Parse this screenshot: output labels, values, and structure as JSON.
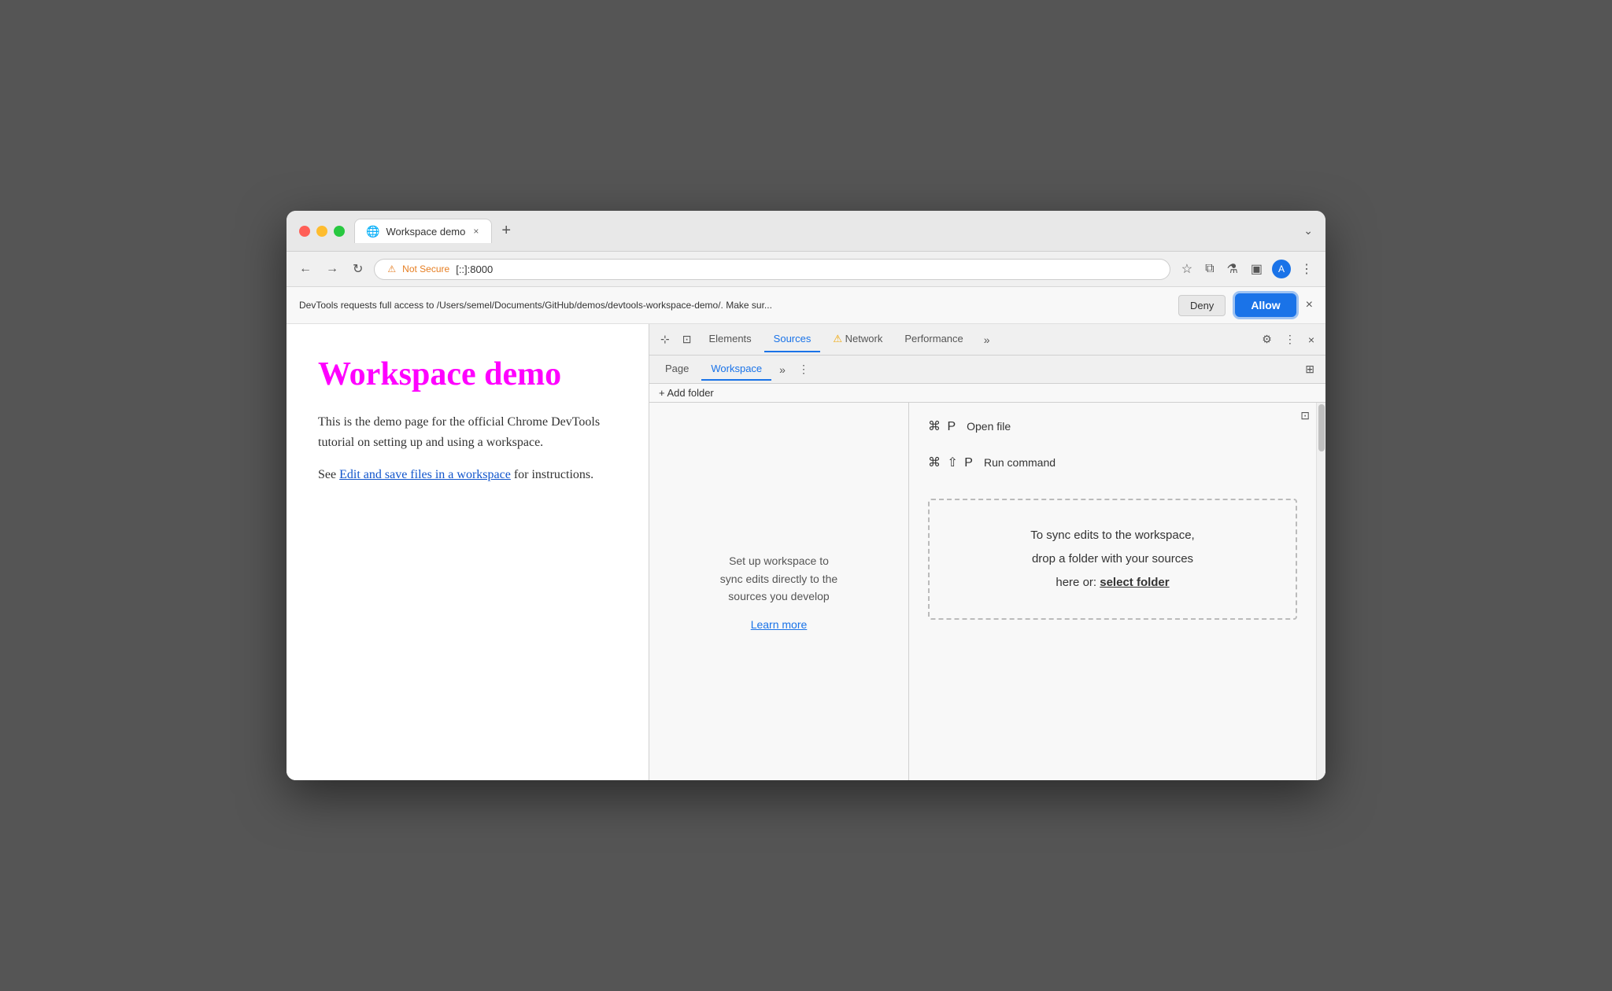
{
  "browser": {
    "tab": {
      "title": "Workspace demo",
      "icon": "🌐"
    },
    "new_tab_label": "+",
    "tab_more_label": "⌄"
  },
  "navbar": {
    "back_btn": "←",
    "forward_btn": "→",
    "reload_btn": "↻",
    "address": {
      "warning_icon": "⚠",
      "warning_text": "Not Secure",
      "url": "[::]:8000"
    },
    "bookmark_icon": "☆",
    "extension_icon": "⧉",
    "experiment_icon": "⚗",
    "sidebar_icon": "▣",
    "profile_initial": "A",
    "menu_icon": "⋮"
  },
  "notification": {
    "text": "DevTools requests full access to /Users/semel/Documents/GitHub/demos/devtools-workspace-demo/. Make sur...",
    "deny_label": "Deny",
    "allow_label": "Allow",
    "close_icon": "×"
  },
  "webpage": {
    "title": "Workspace demo",
    "paragraph1": "This is the demo page for the official Chrome DevTools tutorial on setting up and using a workspace.",
    "paragraph2_prefix": "See ",
    "link_text": "Edit and save files in a workspace",
    "paragraph2_suffix": " for instructions."
  },
  "devtools": {
    "toolbar": {
      "select_icon": "⊹",
      "device_icon": "⊡",
      "tabs": [
        {
          "label": "Elements",
          "active": false
        },
        {
          "label": "Sources",
          "active": true
        },
        {
          "label": "Network",
          "active": false,
          "warning": true
        },
        {
          "label": "Performance",
          "active": false
        }
      ],
      "more_tabs": "»",
      "settings_icon": "⚙",
      "more_icon": "⋮",
      "close_icon": "×"
    },
    "subtoolbar": {
      "tabs": [
        {
          "label": "Page",
          "active": false
        },
        {
          "label": "Workspace",
          "active": true
        }
      ],
      "more_icon": "»",
      "menu_icon": "⋮",
      "toggle_icon": "⊞"
    },
    "add_folder_label": "+ Add folder",
    "workspace_hint": {
      "line1": "Set up workspace to",
      "line2": "sync edits directly to the",
      "line3": "sources you develop"
    },
    "learn_more_label": "Learn more",
    "shortcuts": [
      {
        "keys": "⌘ P",
        "label": "Open file"
      },
      {
        "keys": "⌘ ⇧ P",
        "label": "Run command"
      }
    ],
    "drop_zone": {
      "line1": "To sync edits to the workspace,",
      "line2": "drop a folder with your sources",
      "line3_prefix": "here or: ",
      "select_folder_label": "select folder"
    },
    "collapse_icon": "⊡"
  }
}
